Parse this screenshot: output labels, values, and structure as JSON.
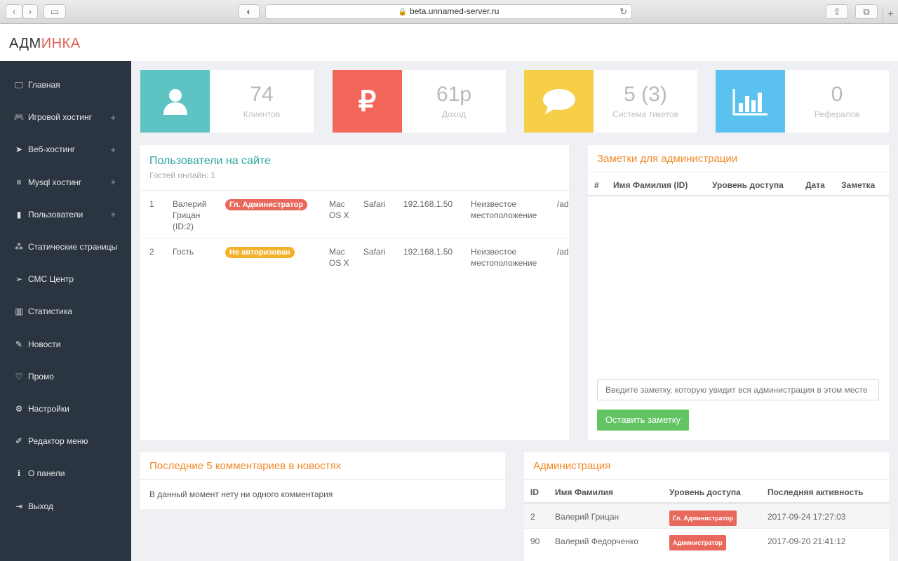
{
  "browser": {
    "url": "beta.unnamed-server.ru"
  },
  "logo": {
    "part1": "АДМ",
    "part2": "ИНКА"
  },
  "sidebar": {
    "items": [
      {
        "label": "Главная",
        "icon": "monitor-icon",
        "glyph": "🖵",
        "expandable": false
      },
      {
        "label": "Игровой хостинг",
        "icon": "gamepad-icon",
        "glyph": "🎮",
        "expandable": true
      },
      {
        "label": "Веб-хостинг",
        "icon": "paper-plane-icon",
        "glyph": "➤",
        "expandable": true
      },
      {
        "label": "Mysql хостинг",
        "icon": "database-icon",
        "glyph": "≡",
        "expandable": true
      },
      {
        "label": "Пользователи",
        "icon": "book-icon",
        "glyph": "▮",
        "expandable": true
      },
      {
        "label": "Статические страницы",
        "icon": "sitemap-icon",
        "glyph": "⁂",
        "expandable": false
      },
      {
        "label": "СМС Центр",
        "icon": "send-icon",
        "glyph": "➢",
        "expandable": false
      },
      {
        "label": "Статистика",
        "icon": "bar-chart-icon",
        "glyph": "▥",
        "expandable": false
      },
      {
        "label": "Новости",
        "icon": "pencil-icon",
        "glyph": "✎",
        "expandable": false
      },
      {
        "label": "Промо",
        "icon": "heart-icon",
        "glyph": "♡",
        "expandable": false
      },
      {
        "label": "Настройки",
        "icon": "gears-icon",
        "glyph": "⚙",
        "expandable": false
      },
      {
        "label": "Редактор меню",
        "icon": "edit-icon",
        "glyph": "✐",
        "expandable": false
      },
      {
        "label": "О панели",
        "icon": "info-icon",
        "glyph": "ℹ",
        "expandable": false
      },
      {
        "label": "Выход",
        "icon": "sign-out-icon",
        "glyph": "⇥",
        "expandable": false
      }
    ],
    "plus": "+"
  },
  "stats": [
    {
      "value": "74",
      "label": "Клиентов",
      "color": "#5ec3c3",
      "icon": "user-icon"
    },
    {
      "value": "61р",
      "label": "Доход",
      "color": "#f3675b",
      "icon": "ruble-icon",
      "glyph": "₽"
    },
    {
      "value": "5 (3)",
      "label": "Система тикетов",
      "color": "#f6ce48",
      "icon": "chat-bubble-icon"
    },
    {
      "value": "0",
      "label": "Рефералов",
      "color": "#5bc1ef",
      "icon": "bar-chart-icon"
    }
  ],
  "online": {
    "title": "Пользователи на сайте",
    "subtitle": "Гостей онлайн: 1",
    "rows": [
      {
        "num": "1",
        "name": "Валерий Грицан (ID:2)",
        "role": "Гл. Администратор",
        "os": "Mac OS X",
        "browser": "Safari",
        "ip": "192.168.1.50",
        "location": "Неизвестое местоположение",
        "path": "/ad"
      },
      {
        "num": "2",
        "name": "Гость",
        "role": "Не авторизован",
        "os": "Mac OS X",
        "browser": "Safari",
        "ip": "192.168.1.50",
        "location": "Неизвестое местоположение",
        "path": "/ad"
      }
    ]
  },
  "notes": {
    "title": "Заметки для администрации",
    "headers": [
      "#",
      "Имя Фамилия (ID)",
      "Уровень доступа",
      "Дата",
      "Заметка"
    ],
    "placeholder": "Введите заметку, которую увидит вся администрация в этом месте",
    "button": "Оставить заметку"
  },
  "comments": {
    "title": "Последние 5 комментариев в новостях",
    "empty": "В данный момент нету ни одного комментария"
  },
  "admins": {
    "title": "Администрация",
    "headers": [
      "ID",
      "Имя Фамилия",
      "Уровень доступа",
      "Последняя активность"
    ],
    "rows": [
      {
        "id": "2",
        "name": "Валерий Грицан",
        "role": "Гл. Администратор",
        "last": "2017-09-24 17:27:03"
      },
      {
        "id": "90",
        "name": "Валерий Федорченко",
        "role": "Администратор",
        "last": "2017-09-20 21:41:12"
      }
    ]
  }
}
